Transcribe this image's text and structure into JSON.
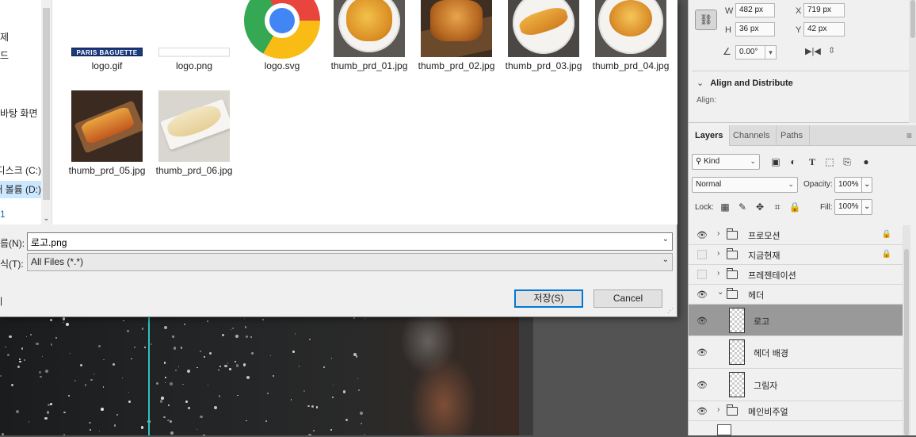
{
  "dialog": {
    "nav_items": [
      "제",
      "드",
      "바탕 화면",
      "로컬 디스크 (C:)",
      "새 볼륨 (D:)",
      "1"
    ],
    "files": [
      {
        "name": "logo.gif",
        "kind": "pb-logo",
        "logo_text": "PARIS BAGUETTE"
      },
      {
        "name": "logo.png",
        "kind": "white-logo"
      },
      {
        "name": "logo.svg",
        "kind": "chrome-icon"
      },
      {
        "name": "thumb_prd_01.jpg",
        "kind": "photo"
      },
      {
        "name": "thumb_prd_02.jpg",
        "kind": "photo"
      },
      {
        "name": "thumb_prd_03.jpg",
        "kind": "photo"
      },
      {
        "name": "thumb_prd_04.jpg",
        "kind": "photo"
      },
      {
        "name": "thumb_prd_05.jpg",
        "kind": "photo"
      },
      {
        "name": "thumb_prd_06.jpg",
        "kind": "photo"
      }
    ],
    "filename_label": "름(N):",
    "filename_value": "로고.png",
    "filetype_label": "식(T):",
    "filetype_value": "All Files (*.*)",
    "save_button": "저장(S)",
    "cancel_button": "Cancel",
    "hide_folders_fragment": "|"
  },
  "properties": {
    "w_label": "W",
    "w_value": "482 px",
    "h_label": "H",
    "h_value": "36 px",
    "x_label": "X",
    "x_value": "719 px",
    "y_label": "Y",
    "y_value": "42 px",
    "angle_value": "0.00°",
    "align_section": "Align and Distribute",
    "align_label": "Align:"
  },
  "layers_panel": {
    "tabs": [
      "Layers",
      "Channels",
      "Paths"
    ],
    "kind_label": "Kind",
    "blend_mode": "Normal",
    "opacity_label": "Opacity:",
    "opacity_value": "100%",
    "lock_label": "Lock:",
    "fill_label": "Fill:",
    "fill_value": "100%",
    "layers": [
      {
        "name": "프로모션",
        "type": "group",
        "visible": true,
        "locked": true,
        "expanded": false
      },
      {
        "name": "지금현재",
        "type": "group",
        "visible": false,
        "locked": true,
        "expanded": false
      },
      {
        "name": "프레젠테이션",
        "type": "group",
        "visible": false,
        "locked": false,
        "expanded": false
      },
      {
        "name": "헤더",
        "type": "group",
        "visible": true,
        "locked": false,
        "expanded": true
      },
      {
        "name": "로고",
        "type": "layer",
        "visible": true,
        "locked": false,
        "selected": true
      },
      {
        "name": "헤더 배경",
        "type": "layer",
        "visible": true,
        "locked": false
      },
      {
        "name": "그림자",
        "type": "layer",
        "visible": true,
        "locked": false
      },
      {
        "name": "메인비주얼",
        "type": "group",
        "visible": true,
        "locked": false,
        "expanded": false
      }
    ]
  },
  "colors": {
    "accent": "#0078d7",
    "guide": "#2ec2c2",
    "selected_layer": "#999999"
  }
}
